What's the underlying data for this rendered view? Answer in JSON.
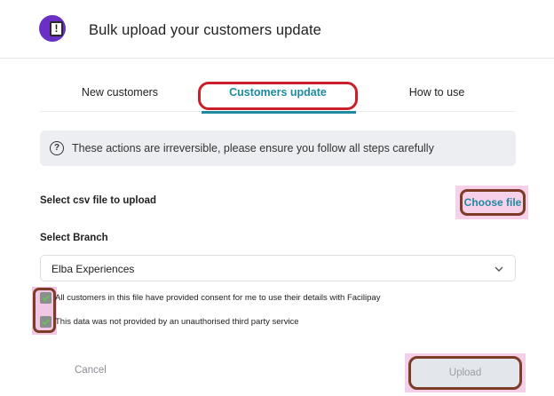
{
  "header": {
    "title": "Bulk upload your customers update",
    "icon": "document-alert-icon"
  },
  "tabs": [
    {
      "label": "New customers"
    },
    {
      "label": "Customers update",
      "active": true
    },
    {
      "label": "How to use"
    }
  ],
  "alert": {
    "icon": "question-circle-icon",
    "text": "These actions are irreversible, please ensure you follow all steps carefully"
  },
  "file": {
    "label": "Select csv file to upload",
    "button": "Choose file"
  },
  "branch": {
    "label": "Select Branch",
    "value": "Elba Experiences"
  },
  "checkboxes": [
    {
      "label": "All customers in this file have provided consent for me to use their details with Facilipay",
      "checked": true
    },
    {
      "label": "This data was not provided by an unauthorised third party service",
      "checked": true
    }
  ],
  "actions": {
    "cancel": "Cancel",
    "upload": "Upload"
  },
  "colors": {
    "accent": "#1e8aa0",
    "brand": "#6a2fc4",
    "annotation_red": "#c9202a",
    "annotation_brown": "#7c3c26"
  }
}
